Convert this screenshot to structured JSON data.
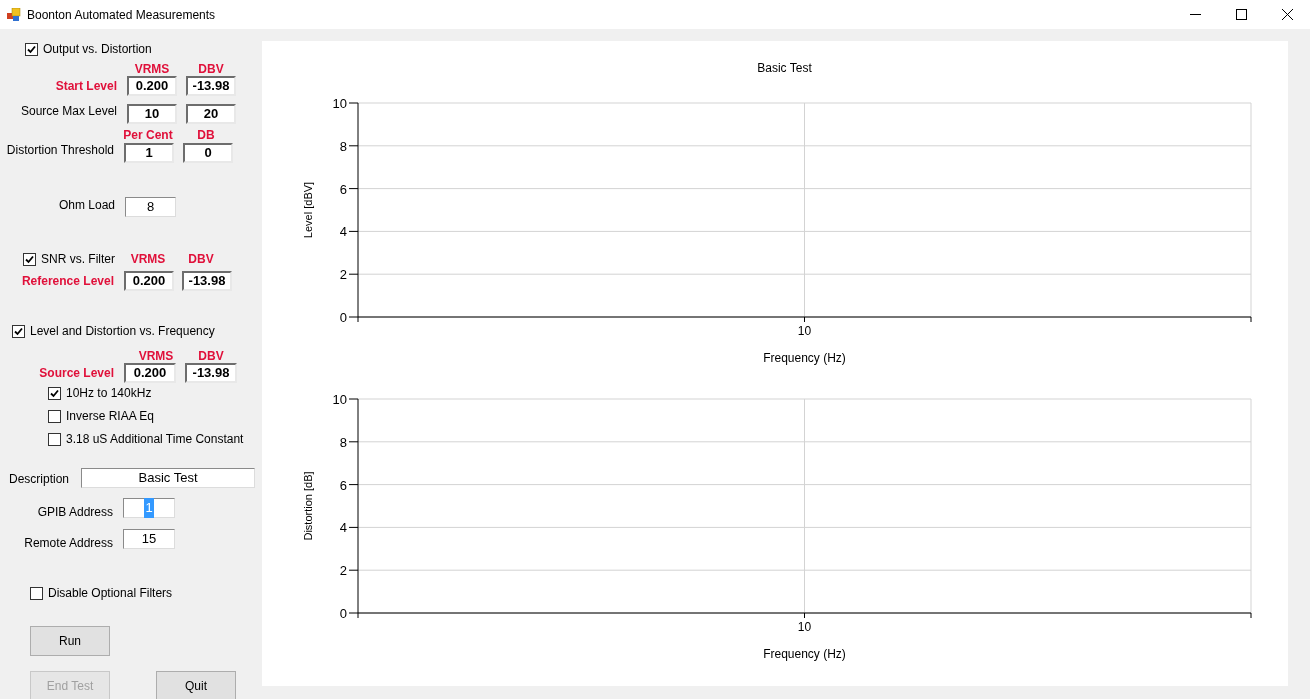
{
  "window": {
    "title": "Boonton Automated Measurements"
  },
  "output_vs_distortion": {
    "label": "Output vs. Distortion",
    "checked": true,
    "units": [
      "VRMS",
      "DBV"
    ],
    "start_level": {
      "label": "Start Level",
      "values": [
        "0.200",
        "-13.98"
      ]
    },
    "source_max_level": {
      "label": "Source Max Level",
      "values": [
        "10",
        "20"
      ]
    },
    "threshold_units": [
      "Per Cent",
      "DB"
    ],
    "distortion_threshold": {
      "label": "Distortion Threshold",
      "values": [
        "1",
        "0"
      ]
    },
    "ohm_load": {
      "label": "Ohm Load",
      "value": "8"
    }
  },
  "snr_vs_filter": {
    "label": "SNR vs. Filter",
    "checked": true,
    "units": [
      "VRMS",
      "DBV"
    ],
    "reference_level": {
      "label": "Reference Level",
      "values": [
        "0.200",
        "-13.98"
      ]
    }
  },
  "level_distortion_vs_frequency": {
    "label": "Level and Distortion vs. Frequency",
    "checked": true,
    "units": [
      "VRMS",
      "DBV"
    ],
    "source_level": {
      "label": "Source Level",
      "values": [
        "0.200",
        "-13.98"
      ]
    },
    "options": [
      {
        "label": "10Hz to 140kHz",
        "checked": true
      },
      {
        "label": "Inverse RIAA Eq",
        "checked": false
      },
      {
        "label": "3.18 uS Additional Time Constant",
        "checked": false
      }
    ]
  },
  "description": {
    "label": "Description",
    "value": "Basic Test"
  },
  "gpib_address": {
    "label": "GPIB Address",
    "value": "1",
    "selected": true
  },
  "remote_address": {
    "label": "Remote Address",
    "value": "15",
    "selected": false
  },
  "disable_optional_filters": {
    "label": "Disable Optional Filters",
    "checked": false
  },
  "buttons": [
    {
      "label": "Run",
      "disabled": false
    },
    {
      "label": "End Test",
      "disabled": true
    },
    {
      "label": "Quit",
      "disabled": false
    }
  ],
  "charts": [
    {
      "chart_data": {
        "type": "line",
        "title": "Basic Test",
        "xlabel": "Frequency (Hz)",
        "ylabel": "Level [dBV]",
        "categories": [
          "10"
        ],
        "series": [
          {
            "values": [
              null
            ]
          }
        ],
        "ylim": [
          0,
          10
        ],
        "yticks": [
          0,
          2,
          4,
          6,
          8,
          10
        ],
        "grid": true
      }
    },
    {
      "chart_data": {
        "type": "line",
        "xlabel": "Frequency (Hz)",
        "ylabel": "Distortion [dB]",
        "categories": [
          "10"
        ],
        "series": [
          {
            "values": [
              null
            ]
          }
        ],
        "ylim": [
          0,
          10
        ],
        "yticks": [
          0,
          2,
          4,
          6,
          8,
          10
        ],
        "grid": true
      }
    }
  ]
}
